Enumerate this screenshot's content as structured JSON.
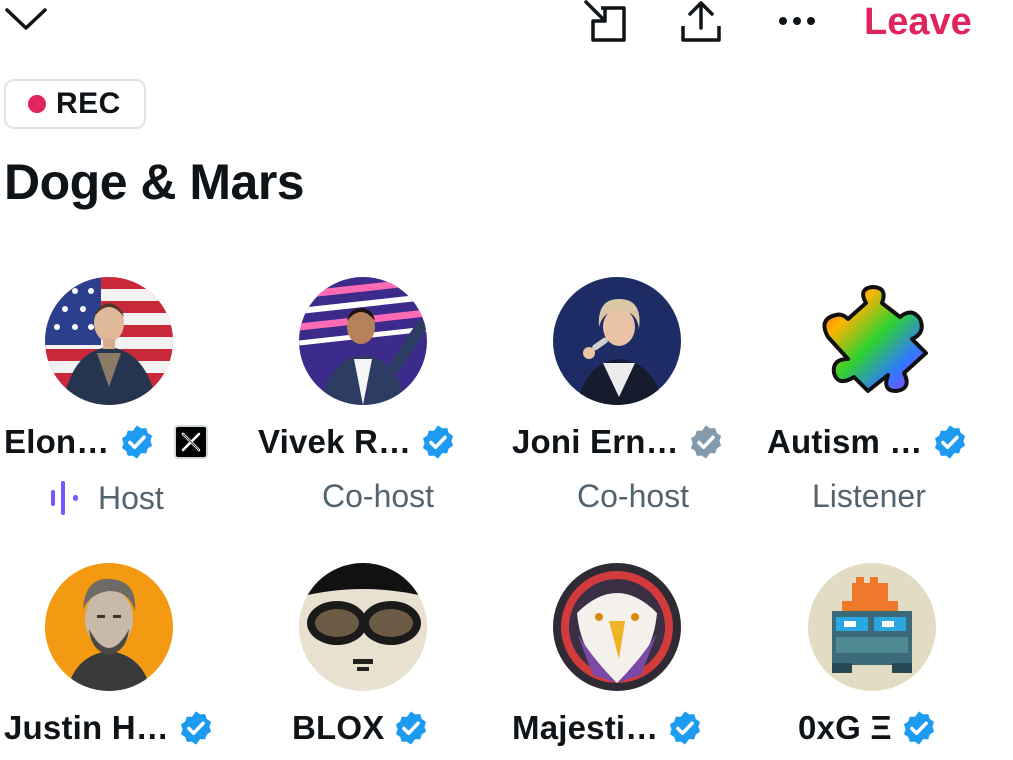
{
  "header": {
    "collapse_icon": "chevron-down-icon",
    "pip_icon": "picture-in-picture-icon",
    "share_icon": "share-icon",
    "more_icon": "more-horizontal-icon",
    "leave_label": "Leave",
    "leave_color": "#e0245e"
  },
  "recording": {
    "label": "REC",
    "dot_color": "#e0245e"
  },
  "space": {
    "title": "Doge & Mars"
  },
  "colors": {
    "verified_blue": "#1d9bf0",
    "verified_gray": "#829aab",
    "speaking_purple": "#7856ff"
  },
  "participants": [
    {
      "name": "Elon…",
      "role": "Host",
      "verified": "blue",
      "affiliate_badge": "X",
      "speaking_icon": "sound-wave-icon"
    },
    {
      "name": "Vivek R…",
      "role": "Co-host",
      "verified": "blue"
    },
    {
      "name": "Joni Ern…",
      "role": "Co-host",
      "verified": "gray"
    },
    {
      "name": "Autism …",
      "role": "Listener",
      "verified": "blue"
    },
    {
      "name": "Justin H…",
      "verified": "blue"
    },
    {
      "name": "BLOX",
      "verified": "blue"
    },
    {
      "name": "Majesti…",
      "verified": "blue"
    },
    {
      "name": "0xG Ξ",
      "verified": "blue"
    }
  ]
}
